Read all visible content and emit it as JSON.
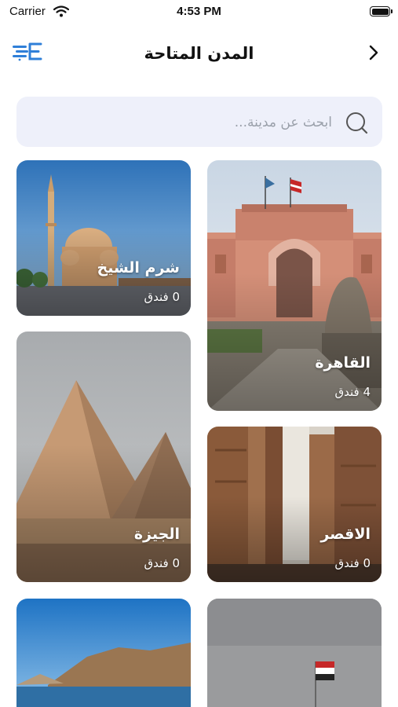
{
  "status_bar": {
    "carrier": "Carrier",
    "time": "4:53 PM",
    "icons": [
      "wifi-icon",
      "battery-icon"
    ]
  },
  "nav": {
    "title": "المدن المتاحة",
    "logo_icon": "app-logo-icon",
    "back_icon": "chevron-right-icon"
  },
  "search": {
    "placeholder": "ابحث عن مدينة...",
    "value": "",
    "icon": "search-icon"
  },
  "colors": {
    "search_bg": "#eef0fa",
    "logo_blue": "#2f7fd8",
    "text_dark": "#111111"
  },
  "cities": [
    {
      "name": "القاهرة",
      "hotels": "4 فندق",
      "image": "egyptian-museum-photo"
    },
    {
      "name": "شرم الشيخ",
      "hotels": "0 فندق",
      "image": "mosque-photo"
    },
    {
      "name": "الاقصر",
      "hotels": "0 فندق",
      "image": "karnak-columns-photo"
    },
    {
      "name": "الجيزة",
      "hotels": "0 فندق",
      "image": "pyramid-photo"
    },
    {
      "name": "",
      "hotels": "",
      "image": "flag-cloudy-sky-photo"
    },
    {
      "name": "",
      "hotels": "",
      "image": "red-sea-mountain-photo"
    }
  ]
}
